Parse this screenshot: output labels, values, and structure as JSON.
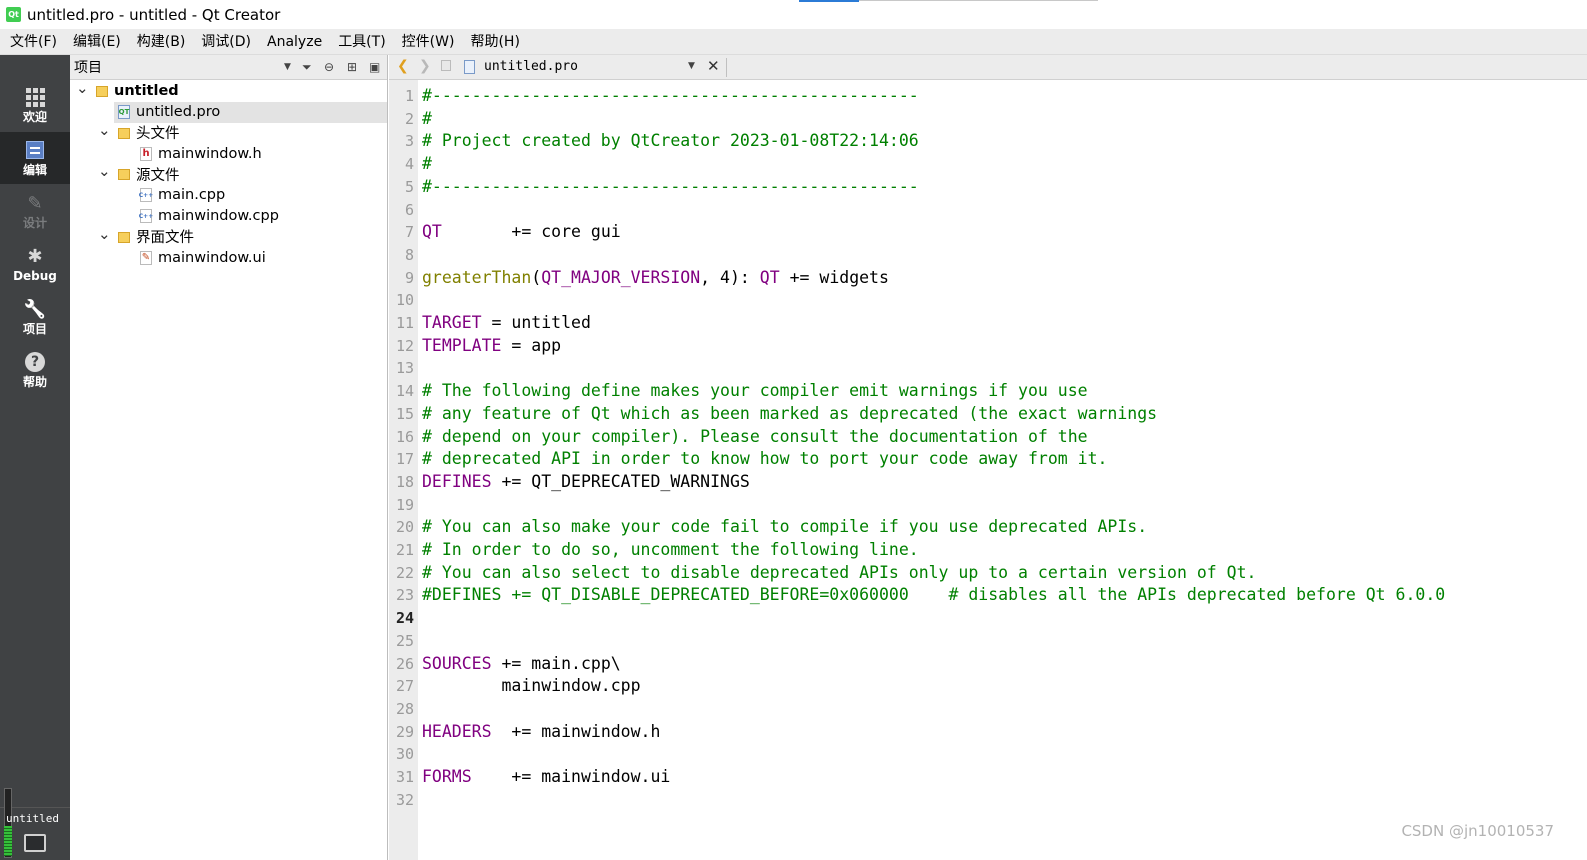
{
  "window": {
    "title": "untitled.pro - untitled - Qt Creator",
    "app_icon_text": "Qt"
  },
  "menubar": [
    "文件(F)",
    "编辑(E)",
    "构建(B)",
    "调试(D)",
    "Analyze",
    "工具(T)",
    "控件(W)",
    "帮助(H)"
  ],
  "modes": [
    {
      "name": "welcome",
      "label": "欢迎",
      "icon": "grid-icon",
      "active": false,
      "enabled": true
    },
    {
      "name": "edit",
      "label": "编辑",
      "icon": "edit-icon",
      "active": true,
      "enabled": true
    },
    {
      "name": "design",
      "label": "设计",
      "icon": "pencil-icon",
      "active": false,
      "enabled": false
    },
    {
      "name": "debug",
      "label": "Debug",
      "icon": "bug-icon",
      "active": false,
      "enabled": true
    },
    {
      "name": "projects",
      "label": "项目",
      "icon": "wrench-icon",
      "active": false,
      "enabled": true
    },
    {
      "name": "help",
      "label": "帮助",
      "icon": "help-icon",
      "active": false,
      "enabled": true
    }
  ],
  "kit": {
    "label": "untitled"
  },
  "project_panel": {
    "title": "项目",
    "tree": [
      {
        "label": "untitled",
        "level": 0,
        "type": "project",
        "expanded": true,
        "bold": true
      },
      {
        "label": "untitled.pro",
        "level": 1,
        "type": "pro",
        "selected": true
      },
      {
        "label": "头文件",
        "level": 1,
        "type": "folder",
        "expanded": true
      },
      {
        "label": "mainwindow.h",
        "level": 2,
        "type": "h"
      },
      {
        "label": "源文件",
        "level": 1,
        "type": "folder",
        "expanded": true
      },
      {
        "label": "main.cpp",
        "level": 2,
        "type": "cpp"
      },
      {
        "label": "mainwindow.cpp",
        "level": 2,
        "type": "cpp"
      },
      {
        "label": "界面文件",
        "level": 1,
        "type": "folder",
        "expanded": true
      },
      {
        "label": "mainwindow.ui",
        "level": 2,
        "type": "ui"
      }
    ]
  },
  "editor": {
    "document": "untitled.pro",
    "current_line": 24,
    "lines": [
      [
        [
          "c",
          "#-------------------------------------------------"
        ]
      ],
      [
        [
          "c",
          "#"
        ]
      ],
      [
        [
          "c",
          "# Project created by QtCreator 2023-01-08T22:14:06"
        ]
      ],
      [
        [
          "c",
          "#"
        ]
      ],
      [
        [
          "c",
          "#-------------------------------------------------"
        ]
      ],
      [],
      [
        [
          "v",
          "QT"
        ],
        [
          "t",
          "       += core gui"
        ]
      ],
      [],
      [
        [
          "f",
          "greaterThan"
        ],
        [
          "t",
          "("
        ],
        [
          "v",
          "QT_MAJOR_VERSION"
        ],
        [
          "t",
          ", 4): "
        ],
        [
          "v",
          "QT"
        ],
        [
          "t",
          " += widgets"
        ]
      ],
      [],
      [
        [
          "v",
          "TARGET"
        ],
        [
          "t",
          " = untitled"
        ]
      ],
      [
        [
          "v",
          "TEMPLATE"
        ],
        [
          "t",
          " = app"
        ]
      ],
      [],
      [
        [
          "c",
          "# The following define makes your compiler emit warnings if you use"
        ]
      ],
      [
        [
          "c",
          "# any feature of Qt which as been marked as deprecated (the exact warnings"
        ]
      ],
      [
        [
          "c",
          "# depend on your compiler). Please consult the documentation of the"
        ]
      ],
      [
        [
          "c",
          "# deprecated API in order to know how to port your code away from it."
        ]
      ],
      [
        [
          "v",
          "DEFINES"
        ],
        [
          "t",
          " += QT_DEPRECATED_WARNINGS"
        ]
      ],
      [],
      [
        [
          "c",
          "# You can also make your code fail to compile if you use deprecated APIs."
        ]
      ],
      [
        [
          "c",
          "# In order to do so, uncomment the following line."
        ]
      ],
      [
        [
          "c",
          "# You can also select to disable deprecated APIs only up to a certain version of Qt."
        ]
      ],
      [
        [
          "c",
          "#DEFINES += QT_DISABLE_DEPRECATED_BEFORE=0x060000    # disables all the APIs deprecated before Qt 6.0.0"
        ]
      ],
      [],
      [],
      [
        [
          "v",
          "SOURCES"
        ],
        [
          "t",
          " += main.cpp\\"
        ]
      ],
      [
        [
          "t",
          "        mainwindow.cpp"
        ]
      ],
      [],
      [
        [
          "v",
          "HEADERS"
        ],
        [
          "t",
          "  += mainwindow.h"
        ]
      ],
      [],
      [
        [
          "v",
          "FORMS"
        ],
        [
          "t",
          "    += mainwindow.ui"
        ]
      ],
      []
    ]
  },
  "watermark": "CSDN @jn10010537",
  "colors": {
    "comment": "#008000",
    "variable": "#800080",
    "function": "#808000",
    "modebar": "#404244"
  }
}
